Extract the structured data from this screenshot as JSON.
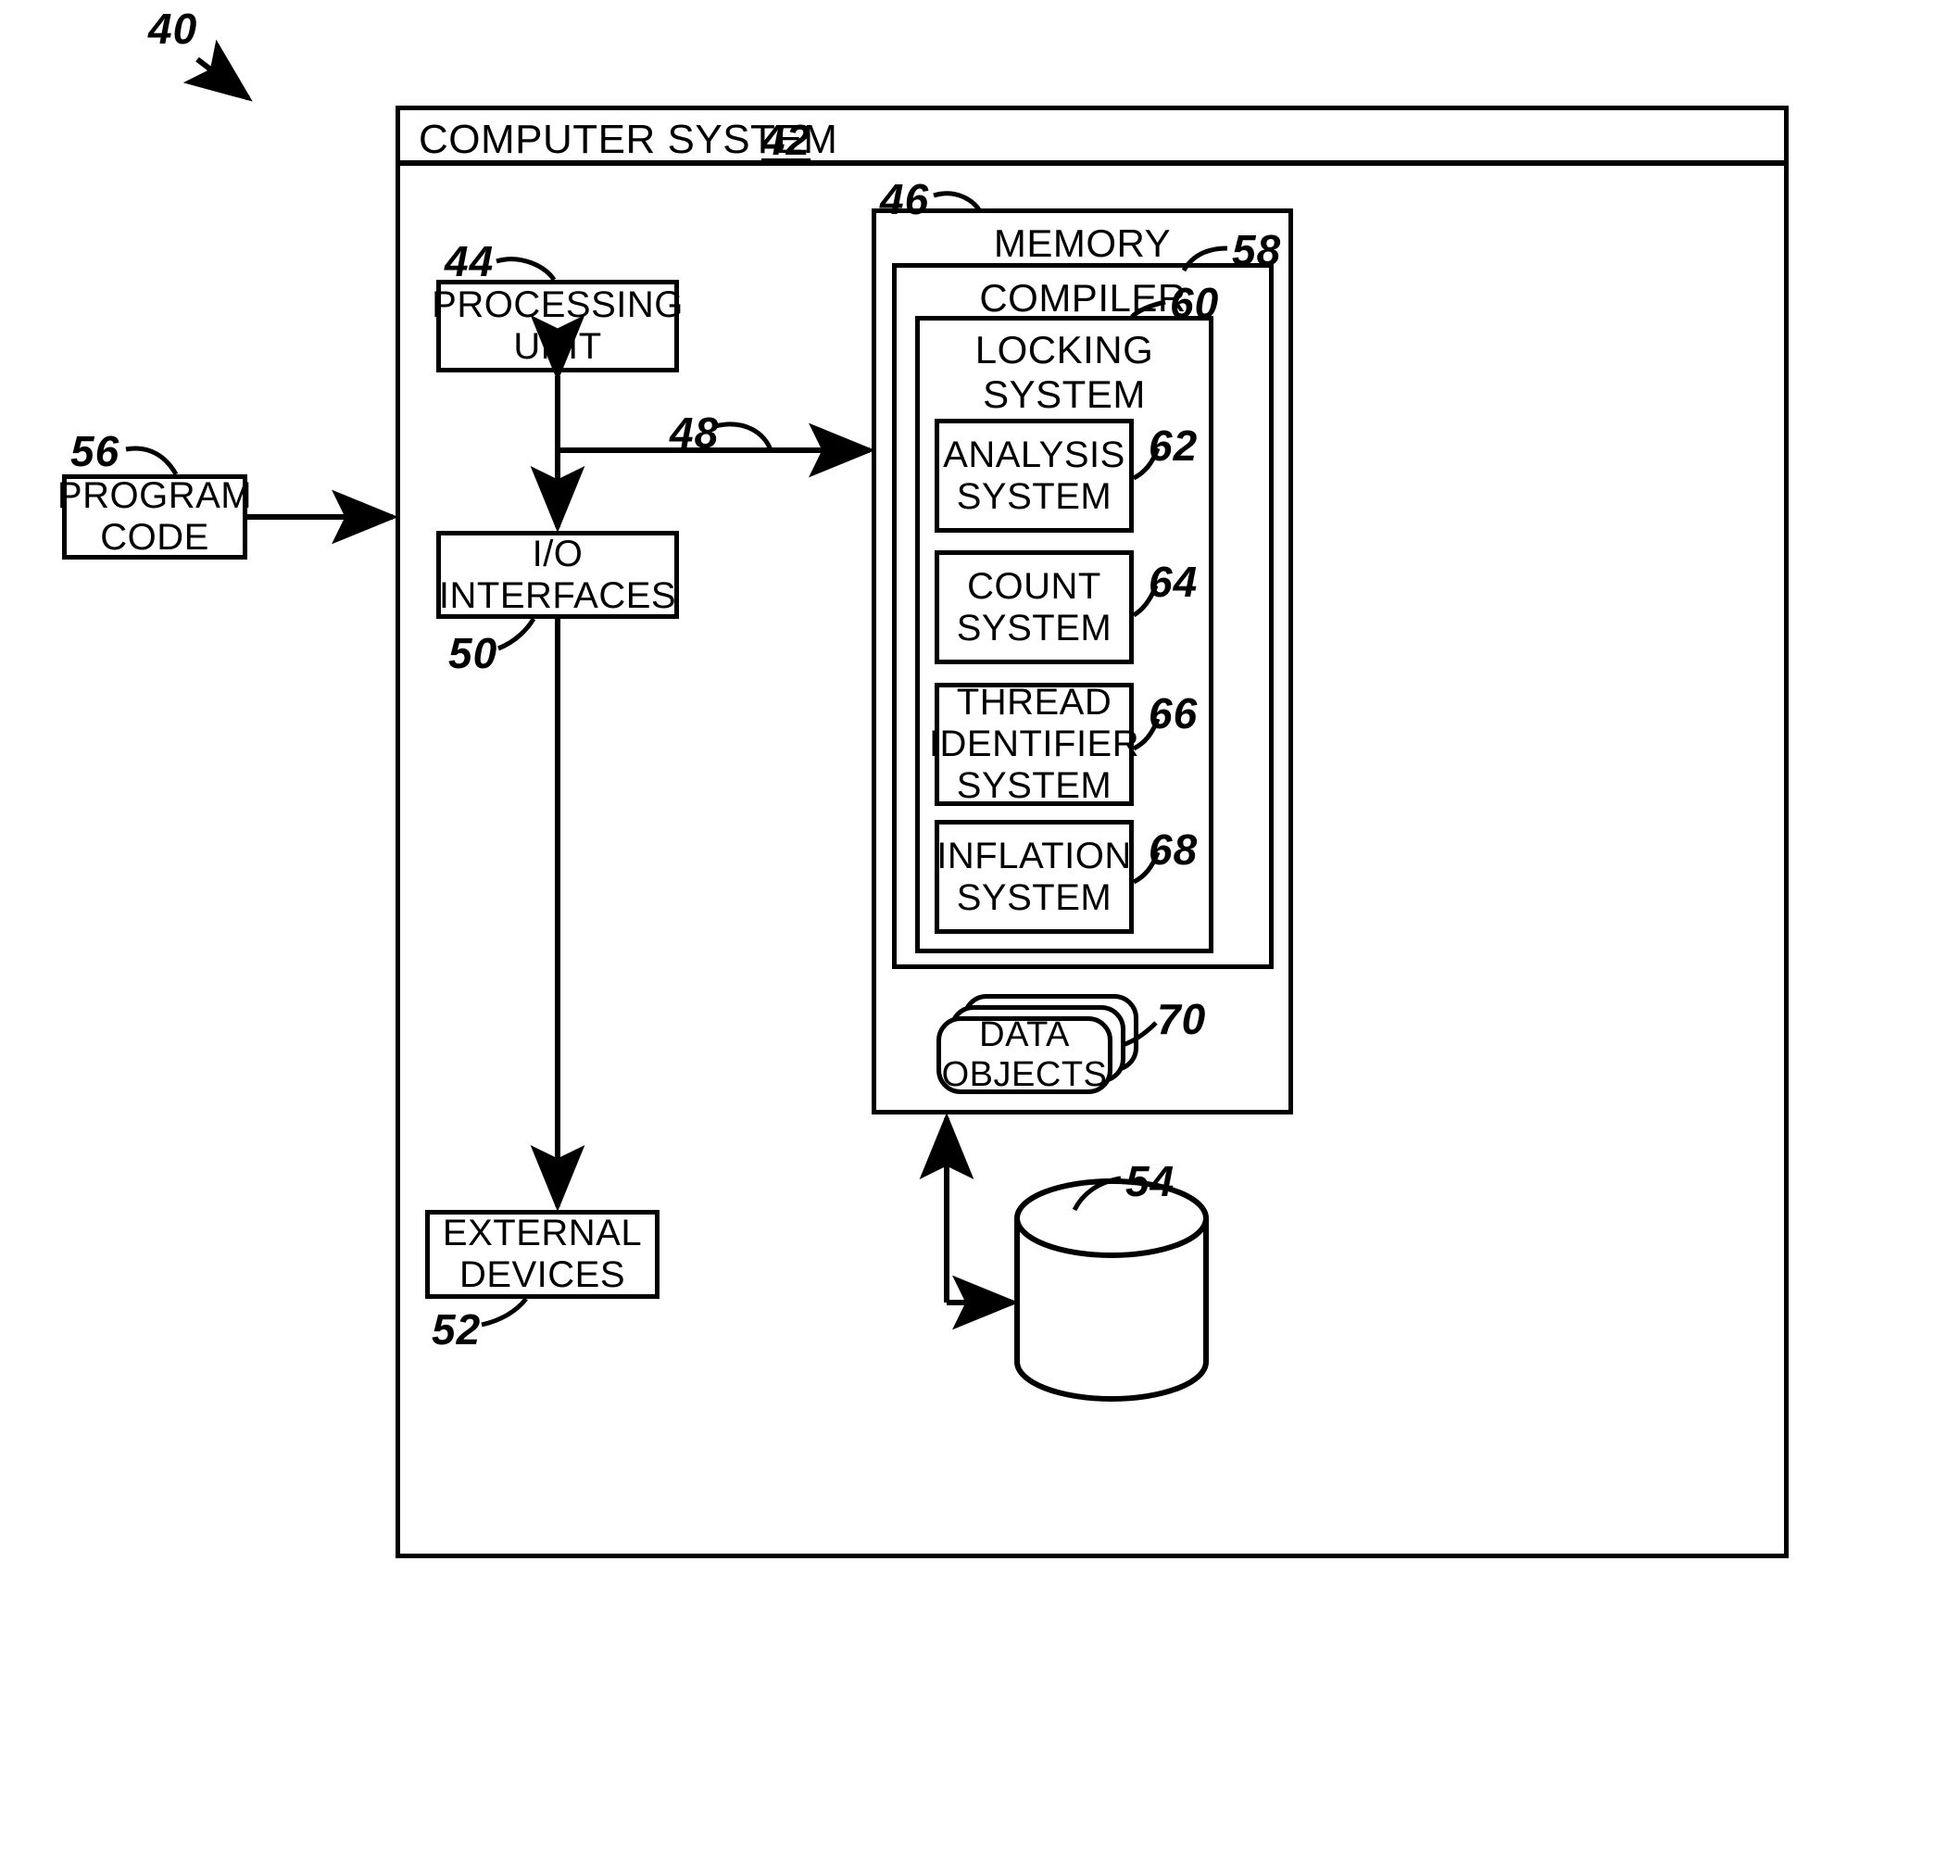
{
  "figure": {
    "ref_main": "40",
    "system": {
      "title": "COMPUTER SYSTEM",
      "ref": "42"
    },
    "blocks": {
      "processing_unit": {
        "label": "PROCESSING\nUNIT",
        "ref": "44"
      },
      "io_interfaces": {
        "label": "I/O\nINTERFACES",
        "ref": "50"
      },
      "program_code": {
        "label": "PROGRAM\nCODE",
        "ref": "56"
      },
      "external_devices": {
        "label": "EXTERNAL\nDEVICES",
        "ref": "52"
      },
      "memory": {
        "label": "MEMORY",
        "ref": "46"
      },
      "compiler": {
        "label": "COMPILER",
        "ref": "58"
      },
      "locking_system": {
        "label": "LOCKING\nSYSTEM",
        "ref": "60"
      },
      "analysis_system": {
        "label": "ANALYSIS\nSYSTEM",
        "ref": "62"
      },
      "count_system": {
        "label": "COUNT\nSYSTEM",
        "ref": "64"
      },
      "thread_identifier_system": {
        "label": "THREAD\nIDENTIFIER\nSYSTEM",
        "ref": "66"
      },
      "inflation_system": {
        "label": "INFLATION\nSYSTEM",
        "ref": "68"
      },
      "data_objects": {
        "label": "DATA\nOBJECTS",
        "ref": "70"
      },
      "storage": {
        "label": "",
        "ref": "54"
      }
    },
    "connectors": {
      "bus_ref": "48"
    }
  }
}
